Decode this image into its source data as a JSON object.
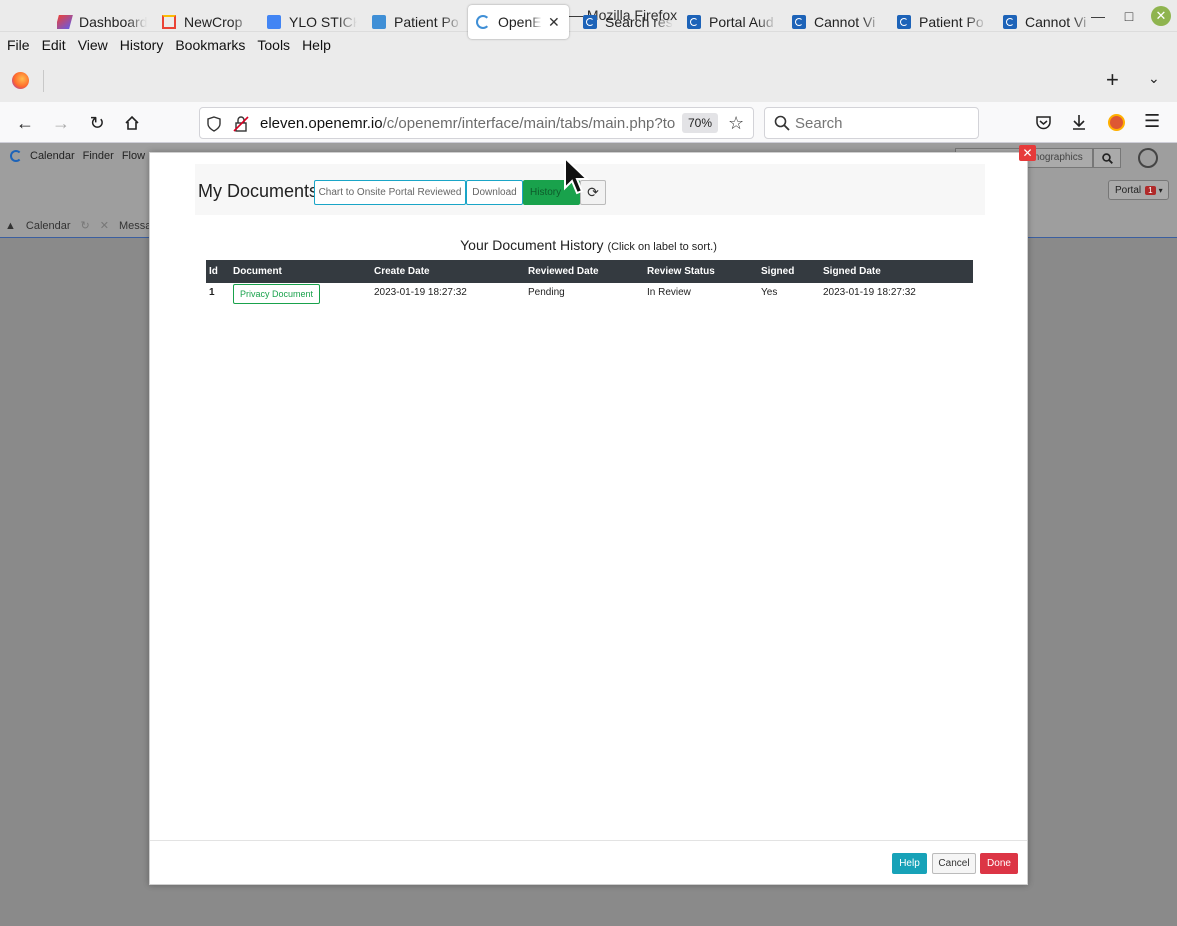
{
  "window": {
    "title": "OpenEMR — Mozilla Firefox"
  },
  "menu": [
    "File",
    "Edit",
    "View",
    "History",
    "Bookmarks",
    "Tools",
    "Help"
  ],
  "tabs": [
    {
      "label": "Dashboard",
      "icon": "dashboard-favicon-icon"
    },
    {
      "label": "NewCrop",
      "icon": "gmail-icon"
    },
    {
      "label": "YLO STICK",
      "icon": "google-docs-icon"
    },
    {
      "label": "Patient Po",
      "icon": "openemr-favicon-icon"
    },
    {
      "label": "OpenEMR",
      "icon": "openemr-favicon-icon",
      "active": true
    },
    {
      "label": "Search res",
      "icon": "openemr-favicon-icon"
    },
    {
      "label": "Portal Aud",
      "icon": "openemr-favicon-icon"
    },
    {
      "label": "Cannot Vi",
      "icon": "openemr-favicon-icon"
    },
    {
      "label": "Patient Po",
      "icon": "openemr-favicon-icon"
    },
    {
      "label": "Cannot Vi",
      "icon": "openemr-favicon-icon"
    }
  ],
  "navbar": {
    "url_host": "eleven.openemr.io",
    "url_path": "/c/openemr/interface/main/tabs/main.php?tok",
    "zoom": "70%",
    "search_placeholder": "Search"
  },
  "app": {
    "nav": [
      "Calendar",
      "Finder",
      "Flow"
    ],
    "tabline": [
      "Calendar",
      "Messa"
    ],
    "search_text": "mographics",
    "portal_label": "Portal",
    "portal_badge": "1"
  },
  "modal": {
    "title": "My Documents",
    "buttons": {
      "chart_reviewed": "Chart to Onsite Portal Reviewed",
      "download": "Download",
      "history": "History"
    },
    "caption": "Your Document History",
    "caption_hint": "(Click on label to sort.)",
    "columns": [
      "Id",
      "Document",
      "Create Date",
      "Reviewed Date",
      "Review Status",
      "Signed",
      "Signed Date"
    ],
    "rows": [
      {
        "id": "1",
        "document": "Privacy Document",
        "create_date": "2023-01-19 18:27:32",
        "reviewed_date": "Pending",
        "review_status": "In Review",
        "signed": "Yes",
        "signed_date": "2023-01-19 18:27:32"
      }
    ],
    "footer": {
      "help": "Help",
      "cancel": "Cancel",
      "done": "Done"
    }
  },
  "colors": {
    "history_button": "#19a24c",
    "table_header": "#343a40",
    "help_button": "#17a2b8",
    "done_button": "#dc3545",
    "close_button": "#e63a3a"
  }
}
